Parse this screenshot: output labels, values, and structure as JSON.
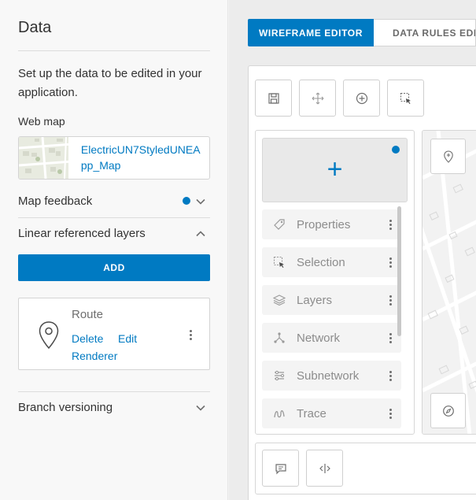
{
  "left_panel": {
    "title": "Data",
    "description": "Set up the data to be edited in your application.",
    "web_map": {
      "label": "Web map",
      "name": "ElectricUN7StyledUNEApp_Map"
    },
    "map_feedback": {
      "label": "Map feedback",
      "indicator_color": "#007ac2"
    },
    "linear_referenced_layers": {
      "label": "Linear referenced layers",
      "add_label": "ADD",
      "route": {
        "name": "Route",
        "delete_label": "Delete",
        "edit_label": "Edit",
        "renderer_label": "Renderer"
      }
    },
    "branch_versioning": {
      "label": "Branch versioning"
    }
  },
  "right_panel": {
    "tabs": [
      {
        "label": "WIREFRAME EDITOR",
        "active": true
      },
      {
        "label": "DATA RULES EDIT",
        "active": false
      }
    ],
    "toolbar_icons": [
      "save-icon",
      "move-icon",
      "add-circle-icon",
      "select-cursor-icon"
    ],
    "add_widget_label": "+",
    "tools": [
      {
        "label": "Properties",
        "icon": "tag-icon"
      },
      {
        "label": "Selection",
        "icon": "selection-icon"
      },
      {
        "label": "Layers",
        "icon": "layers-icon"
      },
      {
        "label": "Network",
        "icon": "network-icon"
      },
      {
        "label": "Subnetwork",
        "icon": "subnetwork-icon"
      },
      {
        "label": "Trace",
        "icon": "trace-icon"
      }
    ],
    "map_icons": [
      "map-pin-icon",
      "compass-icon"
    ],
    "bottom_icons": [
      "comment-icon",
      "split-icon"
    ],
    "accent_color": "#007ac2"
  }
}
